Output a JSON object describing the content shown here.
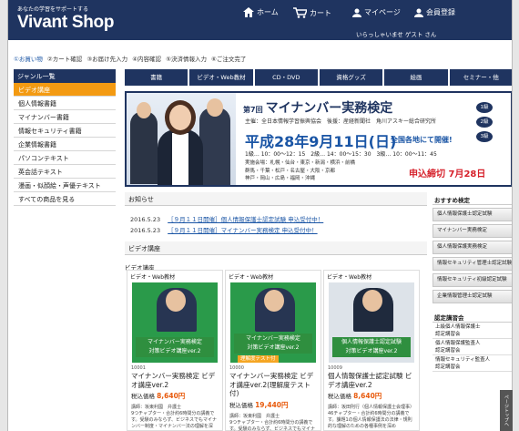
{
  "header": {
    "tagline": "あなたの学習をサポートする",
    "logo": "Vivant Shop",
    "nav": [
      {
        "label": "ホーム",
        "icon": "home-icon"
      },
      {
        "label": "カート",
        "icon": "cart-icon"
      },
      {
        "label": "マイページ",
        "icon": "user-icon"
      },
      {
        "label": "会員登録",
        "icon": "user-add-icon"
      }
    ],
    "welcome": "いらっしゃいませ ゲスト さん"
  },
  "breadcrumb": [
    "①お買い物",
    "②カート確認",
    "③お届け先入力",
    "④内容確認",
    "⑤決済情報入力",
    "⑥ご注文完了"
  ],
  "sidebar": {
    "title": "ジャンル一覧",
    "items": [
      "ビデオ講座",
      "個人情報書籍",
      "マイナンバー書籍",
      "情報セキュリティ書籍",
      "企業情報書籍",
      "パソコンテキスト",
      "英会話テキスト",
      "漫画・似顔絵・声優テキスト",
      "すべての商品を見る"
    ]
  },
  "tabs": [
    "書籍",
    "ビデオ・Web教材",
    "CD・DVD",
    "資格グッズ",
    "絵画",
    "セミナー・他"
  ],
  "banner": {
    "prefix": "第7回",
    "title": "マイナンバー実務検定",
    "sponsor": "主催：全日本情報学習振興協会　後援：産経新聞社　角川アスキー総合研究所",
    "date": "平成28年9月11日(日)",
    "date_note": "全国各地にて開催!",
    "schedule": "1級… 10：00～12：15　2級… 14：00～15：30　3級… 10：00～11：45",
    "venue_lines": [
      "実施会場：札幌・仙台・東京・新潟・横浜・前橋",
      "群馬・千葉・松戸・名古屋・大阪・京都",
      "神戸・岡山・広島・福岡・沖縄"
    ],
    "deadline": "申込締切 7月28日",
    "levels": [
      "1級",
      "2級",
      "3級"
    ]
  },
  "news": {
    "title": "お知らせ",
    "items": [
      {
        "date": "2016.5.23",
        "text": "［９月１１日開催］個人情報保護士認定試験 申込受付中！"
      },
      {
        "date": "2016.5.23",
        "text": "［９月１１日開催］マイナンバー実務検定 申込受付中！"
      }
    ]
  },
  "video_section": {
    "title": "ビデオ講座",
    "label": "ビデオ講座",
    "products": [
      {
        "tag": "ビデオ・Web教材",
        "img_line1": "マイナンバー実務検定",
        "img_line2": "対策ビデオ講座ver.2",
        "img_badge": "",
        "code": "10001",
        "name": "マイナンバー実務検定 ビデオ講座ver.2",
        "price_label": "税込価格",
        "price": "8,640円",
        "desc": "講師：坂東利國　弁護士\n9つチャプター・合計約6時間分の講義です。受験のみならず、ビジネスでもマイナンバー制度・マイナンバー法の理解を深"
      },
      {
        "tag": "ビデオ・Web教材",
        "img_line1": "マイナンバー実務検定",
        "img_line2": "対策ビデオ講座ver.2",
        "img_badge": "理解度テスト付",
        "code": "10000",
        "name": "マイナンバー実務検定 ビデオ講座ver.2(理解度テスト付)",
        "price_label": "税込価格",
        "price": "19,440円",
        "desc": "講師：坂東利國　弁護士\n9つチャプター・合計約6時間分の講義です。受験のみならず、ビジネスでもマイナンバー"
      },
      {
        "tag": "ビデオ・Web教材",
        "img_line1": "個人情報保護士認定試験",
        "img_line2": "対策ビデオ講座ver.2",
        "img_badge": "",
        "code": "10009",
        "name": "個人情報保護士認定試験 ビデオ講座ver.2",
        "price_label": "税込価格",
        "price": "8,640円",
        "desc": "講師：坂田則行（個人情報保護士会理事）\n46チャプター・合計約6時間分の講義です。課題1の個人情報保護法の法律・規則的な理解のための各種事例を深め"
      }
    ]
  },
  "right_sidebar": {
    "recommend_title": "おすすめ検定",
    "recommend": [
      "個人情報保護士認定試験",
      "マイナンバー実務検定",
      "個人情報保護実務検定",
      "情報セキュリティ管理士認定試験",
      "情報セキュリティ初級認定試験",
      "企業情報管理士認定試験"
    ],
    "courses_title": "認定講習会",
    "courses": [
      "上級個人情報保護士\n認定講習会",
      "個人情報保護監査人\n認定講習会",
      "情報セキュリティ監査人\n認定講習会"
    ]
  },
  "page_top": "ページトップへ"
}
